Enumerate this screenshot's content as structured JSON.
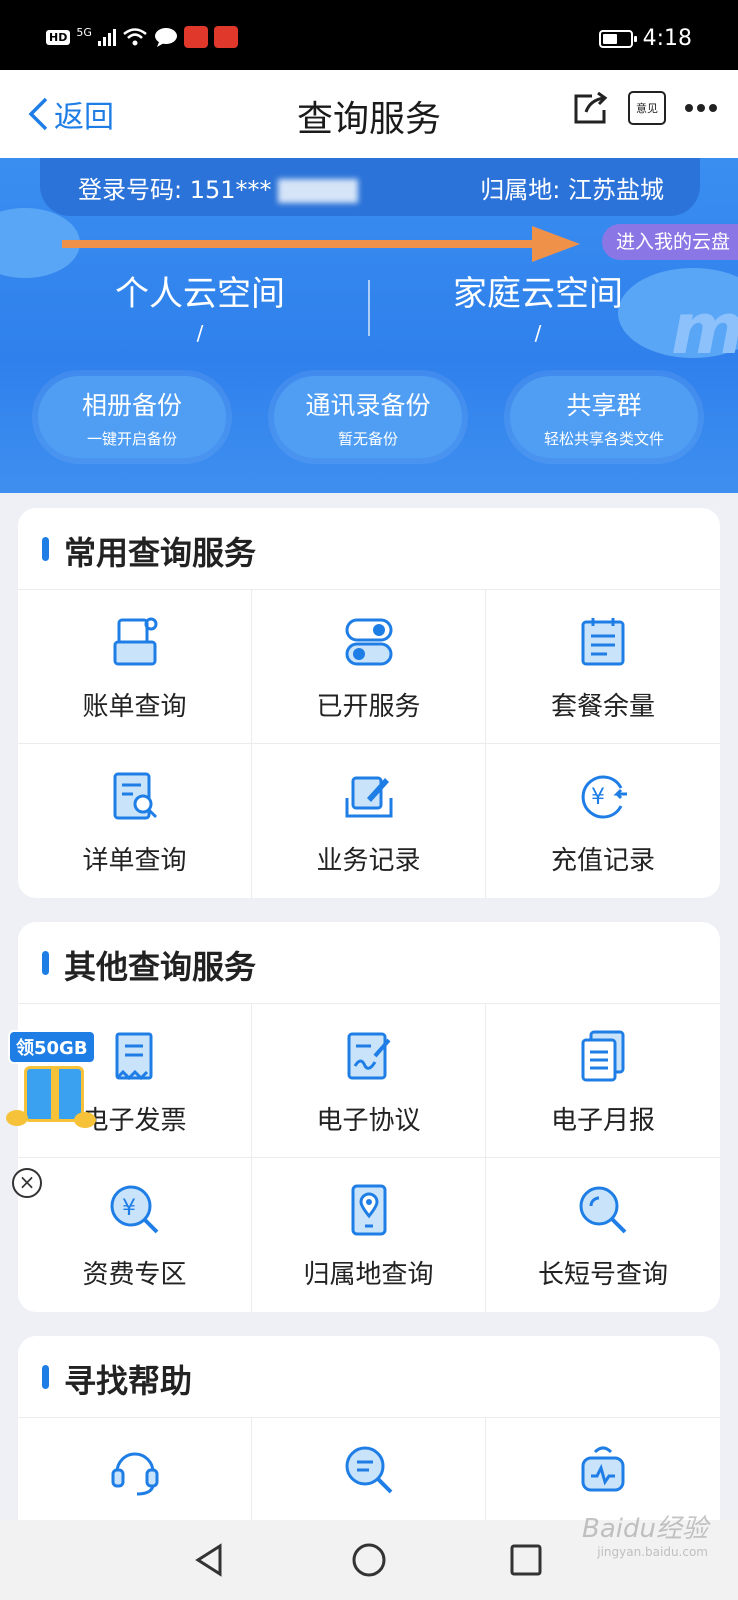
{
  "status_bar": {
    "network": "5G",
    "hd": "HD",
    "time": "4:18"
  },
  "nav": {
    "back_label": "返回",
    "title": "查询服务",
    "feedback_label": "意见"
  },
  "account": {
    "login_label": "登录号码:",
    "login_number": "151***",
    "region_label": "归属地:",
    "region_value": "江苏盐城"
  },
  "cloud_link": "进入我的云盘",
  "spaces": [
    {
      "label": "个人云空间",
      "value": "/"
    },
    {
      "label": "家庭云空间",
      "value": "/"
    }
  ],
  "pills": [
    {
      "title": "相册备份",
      "sub": "一键开启备份"
    },
    {
      "title": "通讯录备份",
      "sub": "暂无备份"
    },
    {
      "title": "共享群",
      "sub": "轻松共享各类文件"
    }
  ],
  "sections": [
    {
      "title": "常用查询服务",
      "items": [
        {
          "label": "账单查询",
          "icon": "bill-icon"
        },
        {
          "label": "已开服务",
          "icon": "toggle-services-icon"
        },
        {
          "label": "套餐余量",
          "icon": "plan-balance-icon"
        },
        {
          "label": "详单查询",
          "icon": "detail-search-icon"
        },
        {
          "label": "业务记录",
          "icon": "business-record-icon"
        },
        {
          "label": "充值记录",
          "icon": "recharge-record-icon"
        }
      ]
    },
    {
      "title": "其他查询服务",
      "items": [
        {
          "label": "电子发票",
          "icon": "e-invoice-icon"
        },
        {
          "label": "电子协议",
          "icon": "e-agreement-icon"
        },
        {
          "label": "电子月报",
          "icon": "e-monthly-report-icon"
        },
        {
          "label": "资费专区",
          "icon": "tariff-icon"
        },
        {
          "label": "归属地查询",
          "icon": "location-phone-icon"
        },
        {
          "label": "长短号查询",
          "icon": "number-search-icon"
        }
      ]
    },
    {
      "title": "寻找帮助",
      "items": [
        {
          "label": "",
          "icon": "customer-service-icon"
        },
        {
          "label": "",
          "icon": "help-search-icon"
        },
        {
          "label": "",
          "icon": "robot-icon"
        }
      ]
    }
  ],
  "promo": {
    "tag": "领50GB"
  },
  "watermark": {
    "brand": "Baidu经验",
    "url": "jingyan.baidu.com"
  },
  "colors": {
    "accent": "#1f7ee6",
    "hero": "#2f80ec",
    "cloud_link": "#8b76e6",
    "arrow": "#f0914a"
  }
}
